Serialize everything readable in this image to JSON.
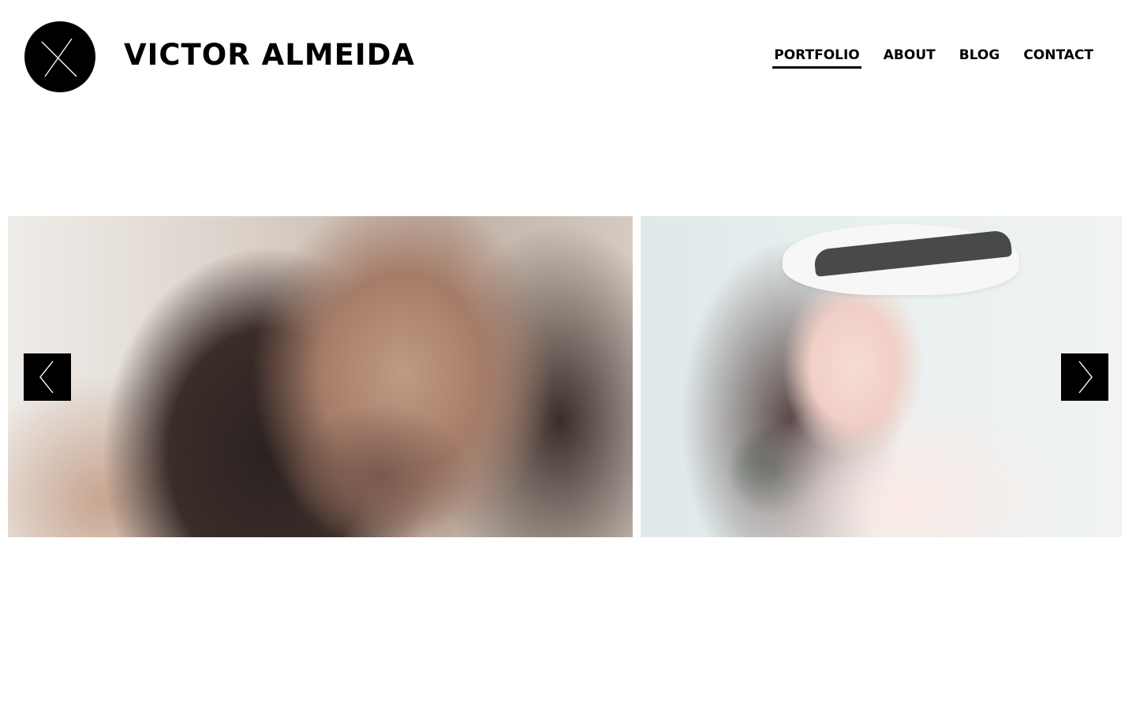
{
  "header": {
    "logo_icon": "x-monogram-icon",
    "site_title": "VICTOR ALMEIDA"
  },
  "nav": {
    "items": [
      {
        "label": "PORTFOLIO",
        "active": true
      },
      {
        "label": "ABOUT",
        "active": false
      },
      {
        "label": "BLOG",
        "active": false
      },
      {
        "label": "CONTACT",
        "active": false
      }
    ]
  },
  "gallery": {
    "prev_icon": "chevron-left-icon",
    "next_icon": "chevron-right-icon",
    "photos": [
      {
        "subject": "woman with dark hair, hands behind head"
      },
      {
        "subject": "woman in white hat with black band"
      }
    ]
  },
  "colors": {
    "background": "#ffffff",
    "text": "#000000",
    "control_bg": "#000000",
    "control_fg": "#ffffff"
  }
}
